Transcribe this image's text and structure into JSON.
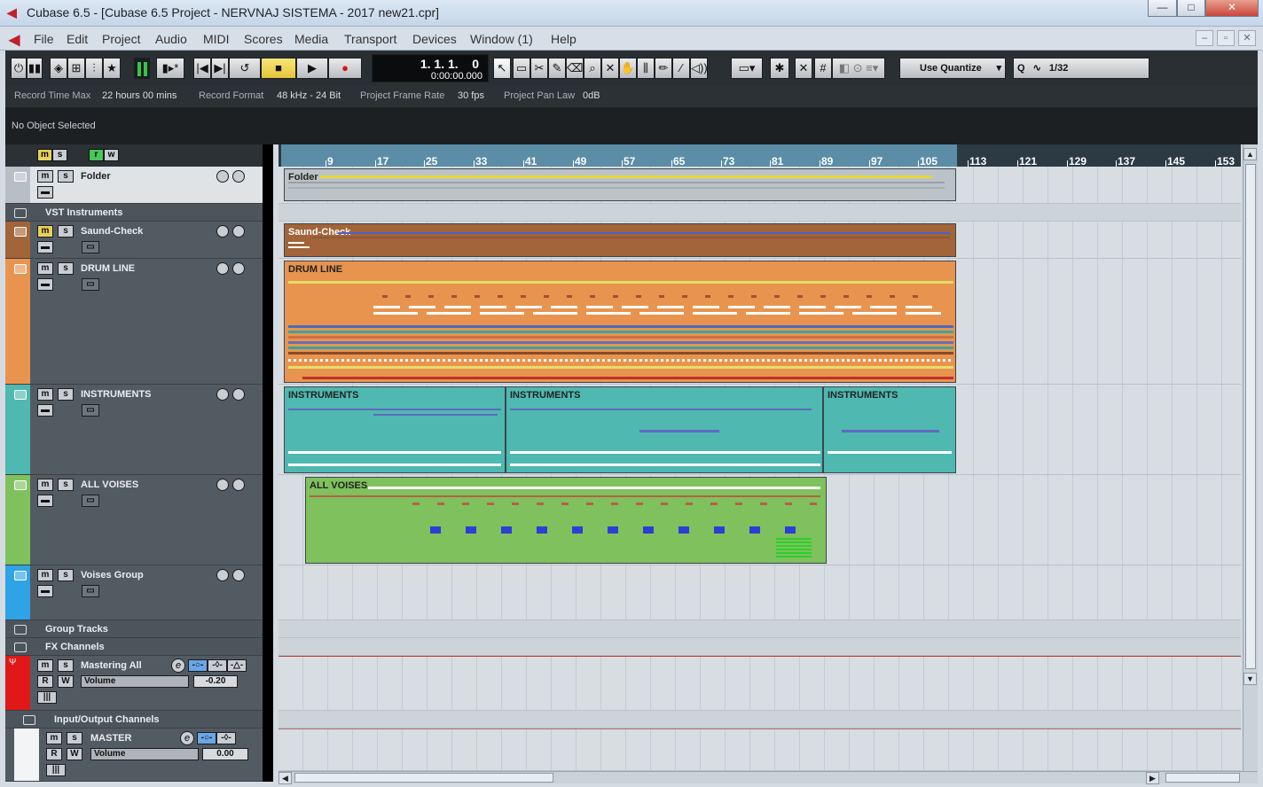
{
  "window": {
    "title": "Cubase 6.5 - [Cubase 6.5 Project - NERVNAJ  SISTEMA - 2017 new21.cpr]",
    "minimize": "—",
    "maximize": "□",
    "close": "✕"
  },
  "menu": [
    "File",
    "Edit",
    "Project",
    "Audio",
    "MIDI",
    "Scores",
    "Media",
    "Transport",
    "Devices",
    "Window (1)",
    "Help"
  ],
  "toolbar": {
    "position_bars": "1. 1. 1.    0",
    "position_time": "0:00:00.000",
    "quantize_mode": "Use Quantize",
    "quantize_icon": "Q",
    "quantize_value": "1/32"
  },
  "infoline": {
    "record_time_label": "Record Time Max",
    "record_time_value": "22 hours 00 mins",
    "record_format_label": "Record Format",
    "record_format_value": "48 kHz - 24 Bit",
    "frame_rate_label": "Project Frame Rate",
    "frame_rate_value": "30 fps",
    "pan_law_label": "Project Pan Law",
    "pan_law_value": "0dB"
  },
  "inspector": {
    "no_object": "No Object Selected"
  },
  "filters": {
    "m": "m",
    "s": "s",
    "r": "r",
    "w": "w"
  },
  "ruler": {
    "ticks": [
      "9",
      "17",
      "25",
      "33",
      "41",
      "49",
      "57",
      "65",
      "73",
      "81",
      "89",
      "97",
      "105",
      "113",
      "121",
      "129",
      "137",
      "145",
      "153"
    ]
  },
  "tracks": [
    {
      "name": "Folder",
      "color": "#b7bec4"
    },
    {
      "name": "VST Instruments"
    },
    {
      "name": "Saund-Check",
      "color": "#a26438"
    },
    {
      "name": "DRUM LINE",
      "color": "#e8944e"
    },
    {
      "name": "INSTRUMENTS",
      "color": "#4fb8b0"
    },
    {
      "name": "ALL VOISES",
      "color": "#7fc15c"
    },
    {
      "name": "Voises Group",
      "color": "#2ea3e6"
    },
    {
      "name": "Group Tracks"
    },
    {
      "name": "FX Channels"
    },
    {
      "name": "Mastering All",
      "color": "#e01818",
      "param": "Volume",
      "value": "-0.20"
    },
    {
      "name": "Input/Output Channels"
    },
    {
      "name": "MASTER",
      "param": "Volume",
      "value": "0.00"
    }
  ],
  "parts": {
    "folder": "Folder",
    "saund": "Saund-Check",
    "drum": "DRUM LINE",
    "instr": "INSTRUMENTS",
    "voises": "ALL VOISES"
  },
  "buttons": {
    "mute": "m",
    "solo": "s",
    "read": "R",
    "write": "W"
  }
}
